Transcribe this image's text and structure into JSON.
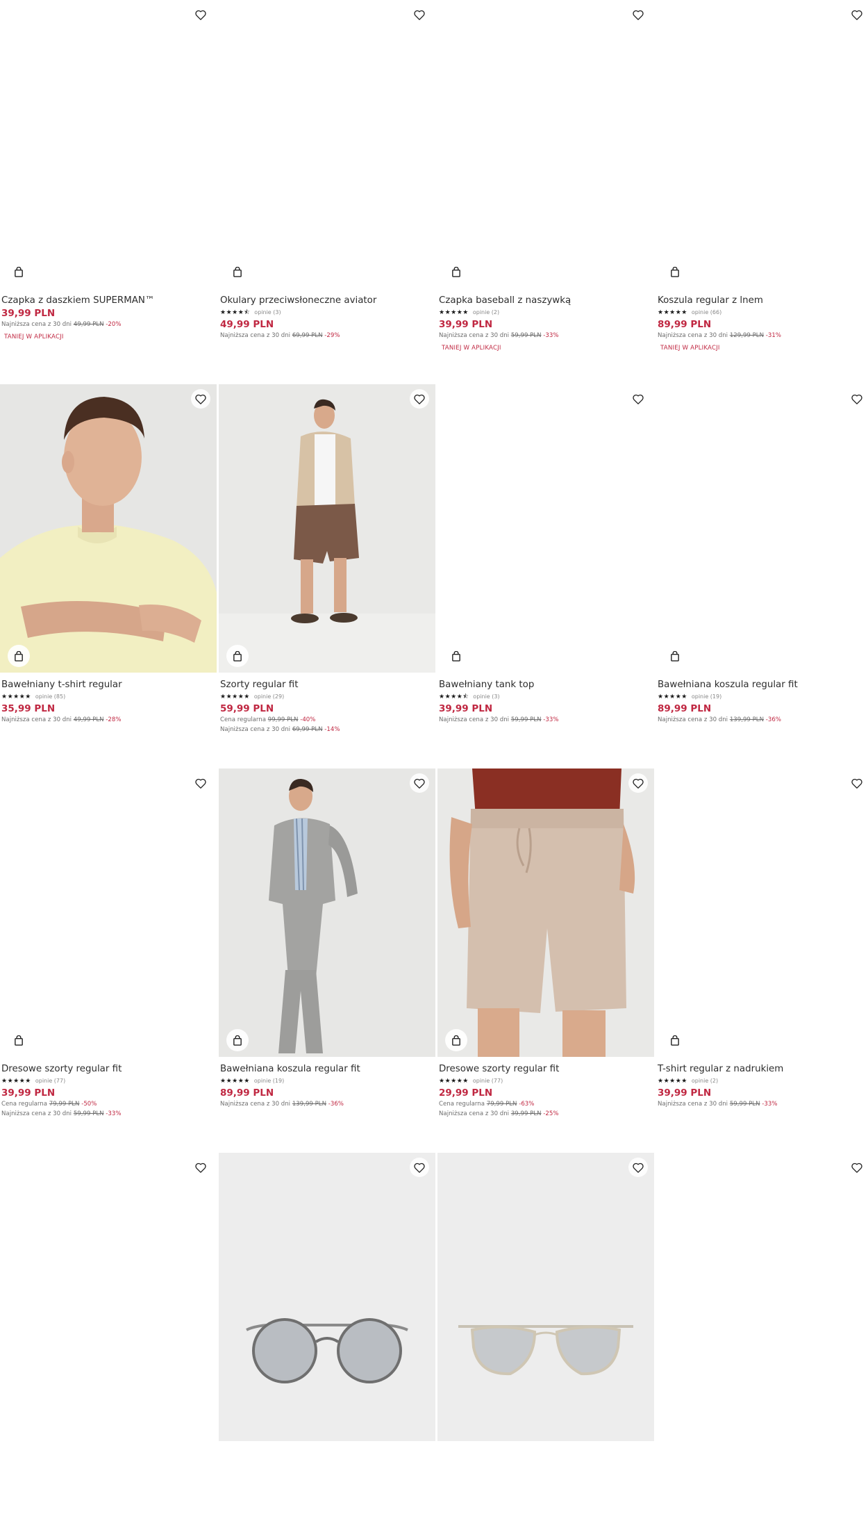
{
  "products": [
    {
      "title": "Czapka z daszkiem SUPERMAN™",
      "price": "39,99 PLN",
      "lowest_label": "Najniższa cena z 30 dni",
      "lowest_price": "49,99 PLN",
      "lowest_discount": "-20%",
      "app_badge": "TANIEJ W APLIKACJI"
    },
    {
      "title": "Okulary przeciwsłoneczne aviator",
      "stars": "★★★★⯪",
      "rating": 4.5,
      "reviews": "opinie (3)",
      "price": "49,99 PLN",
      "lowest_label": "Najniższa cena z 30 dni",
      "lowest_price": "69,99 PLN",
      "lowest_discount": "-29%"
    },
    {
      "title": "Czapka baseball z naszywką",
      "stars": "★★★★★",
      "rating": 5,
      "reviews": "opinie (2)",
      "price": "39,99 PLN",
      "lowest_label": "Najniższa cena z 30 dni",
      "lowest_price": "59,99 PLN",
      "lowest_discount": "-33%",
      "app_badge": "TANIEJ W APLIKACJI"
    },
    {
      "title": "Koszula regular z lnem",
      "stars": "★★★★★",
      "rating": 5,
      "reviews": "opinie (66)",
      "price": "89,99 PLN",
      "lowest_label": "Najniższa cena z 30 dni",
      "lowest_price": "129,99 PLN",
      "lowest_discount": "-31%",
      "app_badge": "TANIEJ W APLIKACJI"
    },
    {
      "title": "Bawełniany t-shirt regular",
      "stars": "★★★★★",
      "rating": 5,
      "reviews": "opinie (85)",
      "price": "35,99 PLN",
      "lowest_label": "Najniższa cena z 30 dni",
      "lowest_price": "49,99 PLN",
      "lowest_discount": "-28%"
    },
    {
      "title": "Szorty regular fit",
      "stars": "★★★★★",
      "rating": 5,
      "reviews": "opinie (29)",
      "price": "59,99 PLN",
      "regular_label": "Cena regularna",
      "regular_price": "99,99 PLN",
      "regular_discount": "-40%",
      "lowest_label": "Najniższa cena z 30 dni",
      "lowest_price": "69,99 PLN",
      "lowest_discount": "-14%"
    },
    {
      "title": "Bawełniany tank top",
      "stars": "★★★★⯪",
      "rating": 4.5,
      "reviews": "opinie (3)",
      "price": "39,99 PLN",
      "lowest_label": "Najniższa cena z 30 dni",
      "lowest_price": "59,99 PLN",
      "lowest_discount": "-33%"
    },
    {
      "title": "Bawełniana koszula regular fit",
      "stars": "★★★★★",
      "rating": 5,
      "reviews": "opinie (19)",
      "price": "89,99 PLN",
      "lowest_label": "Najniższa cena z 30 dni",
      "lowest_price": "139,99 PLN",
      "lowest_discount": "-36%"
    },
    {
      "title": "Dresowe szorty regular fit",
      "stars": "★★★★★",
      "rating": 5,
      "reviews": "opinie (77)",
      "price": "39,99 PLN",
      "regular_label": "Cena regularna",
      "regular_price": "79,99 PLN",
      "regular_discount": "-50%",
      "lowest_label": "Najniższa cena z 30 dni",
      "lowest_price": "59,99 PLN",
      "lowest_discount": "-33%"
    },
    {
      "title": "Bawełniana koszula regular fit",
      "stars": "★★★★★",
      "rating": 5,
      "reviews": "opinie (19)",
      "price": "89,99 PLN",
      "lowest_label": "Najniższa cena z 30 dni",
      "lowest_price": "139,99 PLN",
      "lowest_discount": "-36%"
    },
    {
      "title": "Dresowe szorty regular fit",
      "stars": "★★★★★",
      "rating": 5,
      "reviews": "opinie (77)",
      "price": "29,99 PLN",
      "regular_label": "Cena regularna",
      "regular_price": "79,99 PLN",
      "regular_discount": "-63%",
      "lowest_label": "Najniższa cena z 30 dni",
      "lowest_price": "39,99 PLN",
      "lowest_discount": "-25%"
    },
    {
      "title": "T-shirt regular z nadrukiem",
      "stars": "★★★★★",
      "rating": 5,
      "reviews": "opinie (2)",
      "price": "39,99 PLN",
      "lowest_label": "Najniższa cena z 30 dni",
      "lowest_price": "59,99 PLN",
      "lowest_discount": "-33%"
    },
    {},
    {},
    {},
    {}
  ],
  "colors": {
    "price": "#c02842",
    "text": "#2d2d2d",
    "muted": "#6d6d6d",
    "photo_bg": "#e9e9e9"
  }
}
